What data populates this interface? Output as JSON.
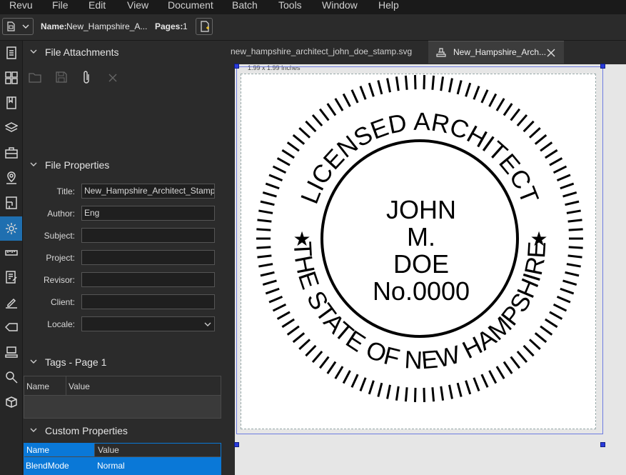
{
  "menu": [
    "Revu",
    "File",
    "Edit",
    "View",
    "Document",
    "Batch",
    "Tools",
    "Window",
    "Help"
  ],
  "toolbar": {
    "name_label": "Name:",
    "name_value": "New_Hampshire_A...",
    "pages_label": "Pages:",
    "pages_value": "1"
  },
  "sections": {
    "attachments": "File Attachments",
    "properties": "File Properties",
    "tags": "Tags - Page 1",
    "custom": "Custom Properties"
  },
  "properties": {
    "title_label": "Title:",
    "title_value": "New_Hampshire_Architect_Stamp",
    "author_label": "Author:",
    "author_value": "Eng",
    "subject_label": "Subject:",
    "subject_value": "",
    "project_label": "Project:",
    "project_value": "",
    "revisor_label": "Revisor:",
    "revisor_value": "",
    "client_label": "Client:",
    "client_value": "",
    "locale_label": "Locale:",
    "locale_value": ""
  },
  "tags_table": {
    "col_name": "Name",
    "col_value": "Value"
  },
  "custom_table": {
    "col_name": "Name",
    "col_value": "Value",
    "row_name": "BlendMode",
    "row_value": "Normal"
  },
  "tabs": {
    "tab1": "new_hampshire_architect_john_doe_stamp.svg",
    "tab2": "New_Hampshire_Arch..."
  },
  "canvas": {
    "size_label": "1.99 x 1.99 Inches"
  },
  "stamp": {
    "top_text": "LICENSED ARCHITECT",
    "bottom_text": "THE STATE OF NEW HAMPSHIRE",
    "line1": "JOHN",
    "line2": "M.",
    "line3": "DOE",
    "line4": "No.0000"
  },
  "colors": {
    "accent": "#1f6fb0",
    "selection_row": "#0a78d7",
    "handle": "#2a3bdc"
  }
}
